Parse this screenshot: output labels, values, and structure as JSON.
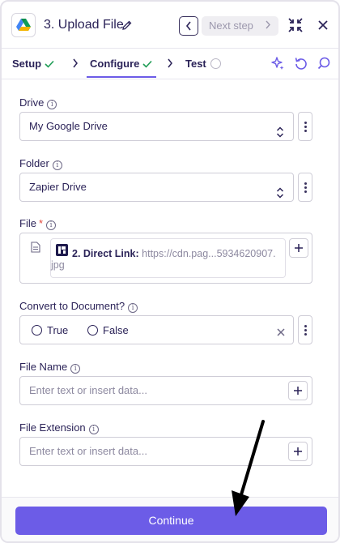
{
  "header": {
    "title": "3. Upload File",
    "next_step_label": "Next step",
    "app_icon": "google-drive-logo",
    "edit_icon": "pencil-icon",
    "collapse_icon": "collapse-icon",
    "close_icon": "close-icon"
  },
  "tabs": [
    {
      "label": "Setup",
      "status": "complete"
    },
    {
      "label": "Configure",
      "status": "complete",
      "active": true
    },
    {
      "label": "Test",
      "status": "pending"
    }
  ],
  "toolbar_icons": [
    "sparkle-icon",
    "refresh-icon",
    "search-icon"
  ],
  "fields": {
    "drive": {
      "label": "Drive",
      "value": "My Google Drive"
    },
    "folder": {
      "label": "Folder",
      "value": "Zapier Drive"
    },
    "file": {
      "label": "File",
      "required_mark": "*",
      "chip_step": "2. Direct Link:",
      "chip_value_line1": "https://cdn.pag...5934620907.",
      "chip_value_line2": "jpg"
    },
    "convert": {
      "label": "Convert to Document?",
      "options": [
        "True",
        "False"
      ],
      "selected": null
    },
    "file_name": {
      "label": "File Name",
      "placeholder": "Enter text or insert data..."
    },
    "file_extension": {
      "label": "File Extension",
      "placeholder": "Enter text or insert data..."
    }
  },
  "footer": {
    "continue_label": "Continue"
  },
  "colors": {
    "accent": "#6c5ce7",
    "text": "#2b2358",
    "check": "#1f9d55",
    "required": "#e2473b"
  }
}
